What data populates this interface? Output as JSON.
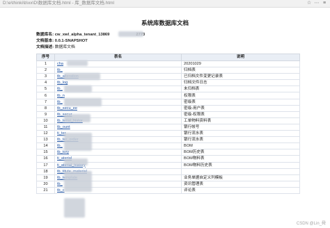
{
  "browser": {
    "tab_title": "D:\\e\\thinki\\b\\xx\\D\\数据库文档.html - 库_数据库文档.html"
  },
  "document": {
    "title": "系统库数据库文档",
    "meta": [
      {
        "label": "数据库名:",
        "value": "cw_xwl_alpha_tenant_13869",
        "value_suffix": "2773"
      },
      {
        "label": "文档版本:",
        "value": "0.0.1-SNAPSHOT",
        "value_suffix": ""
      },
      {
        "label": "文档描述:",
        "value": "数据库文档",
        "value_suffix": ""
      }
    ]
  },
  "table": {
    "headers": [
      "序号",
      "表名",
      "说明"
    ],
    "rows": [
      {
        "no": "1",
        "name": "cha",
        "desc": "20201029"
      },
      {
        "no": "2",
        "name": "tb_",
        "desc": "归档表"
      },
      {
        "no": "3",
        "name": "tb_alteration",
        "desc": "已归档文件变更记录表"
      },
      {
        "no": "4",
        "name": "tb_log",
        "desc": "归档文件日志"
      },
      {
        "no": "5",
        "name": "tb_",
        "desc": "未归档表"
      },
      {
        "no": "6",
        "name": "tb_n",
        "desc": "权限表"
      },
      {
        "no": "7",
        "name": "tb_",
        "desc": "密级表"
      },
      {
        "no": "8",
        "name": "tb_secu_ee",
        "desc": "密级-用户表"
      },
      {
        "no": "9",
        "name": "tb_secur",
        "desc": "密级-权限表"
      },
      {
        "no": "10",
        "name": "tb_terial_histor",
        "desc": "工单物料资料表"
      },
      {
        "no": "11",
        "name": "tb_ount",
        "desc": "银行帐号"
      },
      {
        "no": "12",
        "name": "ti_ter",
        "desc": "银行流水表"
      },
      {
        "no": "13",
        "name": "tb_ter_order",
        "desc": "银行流水表"
      },
      {
        "no": "14",
        "name": "tb_",
        "desc": "BOM"
      },
      {
        "no": "15",
        "name": "tb_tory",
        "desc": "BOM历史表"
      },
      {
        "no": "16",
        "name": "ti_aterial",
        "desc": "BOM物料表"
      },
      {
        "no": "17",
        "name": "ti_aterial_history",
        "desc": "BOM物料历史表"
      },
      {
        "no": "18",
        "name": "tb_titute_material",
        "desc": ""
      },
      {
        "no": "19",
        "name": "tb_template",
        "desc": "业务单据自定义列模板"
      },
      {
        "no": "20",
        "name": "tb_",
        "desc": "资讯管理表"
      },
      {
        "no": "21",
        "name": "tb_c",
        "desc": "评论表"
      }
    ]
  },
  "watermark": "CSDN @Lin_舜"
}
